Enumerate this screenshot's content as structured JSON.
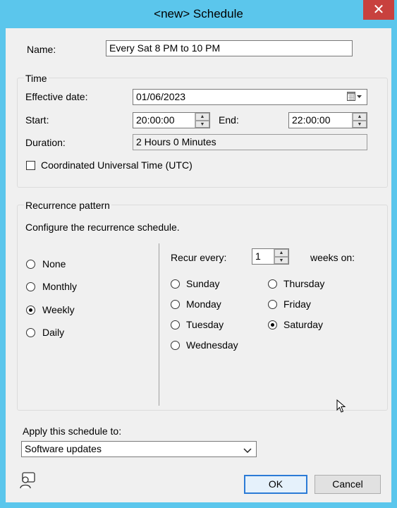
{
  "window": {
    "title": "<new> Schedule",
    "close_glyph": "✕"
  },
  "name": {
    "label": "Name:",
    "value": "Every Sat 8 PM to 10 PM"
  },
  "time": {
    "legend": "Time",
    "effective_label": "Effective date:",
    "effective_value": "01/06/2023",
    "start_label": "Start:",
    "start_value": "20:00:00",
    "end_label": "End:",
    "end_value": "22:00:00",
    "duration_label": "Duration:",
    "duration_value": "2 Hours 0 Minutes",
    "utc_label": "Coordinated Universal Time (UTC)",
    "utc_checked": false
  },
  "recurrence": {
    "legend": "Recurrence pattern",
    "description": "Configure the recurrence schedule.",
    "patterns": [
      {
        "label": "None",
        "selected": false
      },
      {
        "label": "Monthly",
        "selected": false
      },
      {
        "label": "Weekly",
        "selected": true
      },
      {
        "label": "Daily",
        "selected": false
      }
    ],
    "recur_every_label": "Recur every:",
    "recur_every_value": "1",
    "weeks_on_label": "weeks on:",
    "days": [
      {
        "label": "Sunday",
        "selected": false
      },
      {
        "label": "Monday",
        "selected": false
      },
      {
        "label": "Tuesday",
        "selected": false
      },
      {
        "label": "Wednesday",
        "selected": false
      },
      {
        "label": "Thursday",
        "selected": false
      },
      {
        "label": "Friday",
        "selected": false
      },
      {
        "label": "Saturday",
        "selected": true
      }
    ]
  },
  "apply": {
    "label": "Apply this schedule to:",
    "value": "Software updates"
  },
  "buttons": {
    "ok": "OK",
    "cancel": "Cancel"
  },
  "icons": {
    "calendar": "calendar-icon",
    "chevron": "chevron-down-icon",
    "help": "help-person-icon"
  }
}
